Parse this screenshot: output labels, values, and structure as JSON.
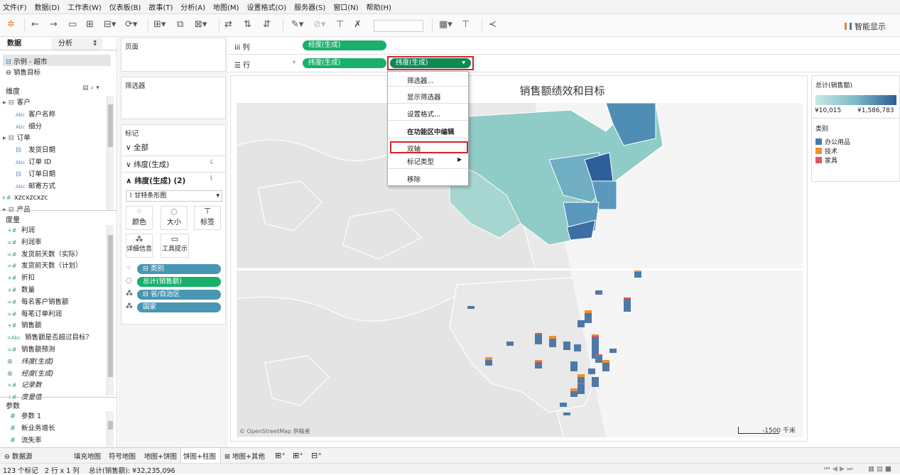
{
  "menu": [
    "文件(F)",
    "数据(D)",
    "工作表(W)",
    "仪表板(B)",
    "故事(T)",
    "分析(A)",
    "地图(M)",
    "设置格式(O)",
    "服务器(S)",
    "窗口(N)",
    "帮助(H)"
  ],
  "toolbar": {
    "smart_show": "智能显示"
  },
  "left": {
    "tab_data": "数据",
    "tab_analysis": "分析",
    "datasources": [
      "示例 - 超市",
      "销售目标"
    ],
    "dimensions_title": "维度",
    "dimensions": [
      {
        "label": "客户",
        "kind": "folder"
      },
      {
        "label": "客户名称",
        "kind": "abc"
      },
      {
        "label": "细分",
        "kind": "abc"
      },
      {
        "label": "订单",
        "kind": "folder"
      },
      {
        "label": "发货日期",
        "kind": "date"
      },
      {
        "label": "订单 ID",
        "kind": "abc"
      },
      {
        "label": "订单日期",
        "kind": "date"
      },
      {
        "label": "邮寄方式",
        "kind": "abc"
      },
      {
        "label": "xzcxzcxzc",
        "kind": "num"
      },
      {
        "label": "产品",
        "kind": "folder"
      }
    ],
    "measures_title": "度量",
    "measures": [
      {
        "label": "利润",
        "kind": "num"
      },
      {
        "label": "利润率",
        "kind": "numc"
      },
      {
        "label": "发货前天数（实际）",
        "kind": "numc"
      },
      {
        "label": "发货前天数（计划）",
        "kind": "numc"
      },
      {
        "label": "折扣",
        "kind": "num"
      },
      {
        "label": "数量",
        "kind": "num"
      },
      {
        "label": "每名客户销售额",
        "kind": "numc"
      },
      {
        "label": "每笔订单利润",
        "kind": "numc"
      },
      {
        "label": "销售额",
        "kind": "num"
      },
      {
        "label": "销售额是否超过目标？",
        "kind": "abcc"
      },
      {
        "label": "销售额预测",
        "kind": "numc"
      },
      {
        "label": "纬度(生成)",
        "kind": "geo"
      },
      {
        "label": "经度(生成)",
        "kind": "geo"
      },
      {
        "label": "记录数",
        "kind": "num"
      },
      {
        "label": "度量值",
        "kind": "num"
      }
    ],
    "params_title": "参数",
    "params": [
      "参数 1",
      "新业务增长",
      "流失率"
    ]
  },
  "middle": {
    "pages_title": "页面",
    "filters_title": "筛选器",
    "marks_title": "标记",
    "marks_all": "全部",
    "marks_lon": "纬度(生成)",
    "marks_lat": "纬度(生成) (2)",
    "mark_type": "甘特条形图",
    "btn_color": "颜色",
    "btn_size": "大小",
    "btn_label": "标签",
    "btn_detail": "详细信息",
    "btn_tooltip": "工具提示",
    "pills": [
      "类别",
      "总计(销售额)",
      "省/自治区",
      "国家"
    ]
  },
  "shelves": {
    "columns_label": "列",
    "rows_label": "行",
    "col_pill": "经度(生成)",
    "row_pill1": "纬度(生成)",
    "row_pill2": "纬度(生成)"
  },
  "view": {
    "title": "销售额绩效和目标",
    "attribution": "© OpenStreetMap 供稿者",
    "scale": "1500 千米"
  },
  "dropdown": {
    "items": [
      "筛选器...",
      "显示筛选器",
      "设置格式...",
      "在功能区中编辑",
      "双轴",
      "标记类型",
      "移除"
    ]
  },
  "legend": {
    "title": "总计(销售额)",
    "min": "¥10,015",
    "max": "¥1,586,783",
    "cat_title": "类别",
    "categories": [
      {
        "name": "办公用品",
        "color": "#4e79a7"
      },
      {
        "name": "技术",
        "color": "#f28e2b"
      },
      {
        "name": "家具",
        "color": "#e15759"
      }
    ]
  },
  "colors": {
    "green_pill": "#18b06b",
    "blue_pill": "#4996b2",
    "highlight": "#d4232b"
  },
  "tabs": {
    "datasource": "数据源",
    "sheets": [
      "填充地图",
      "符号地图",
      "地图+饼图",
      "饼图+柱图",
      "地图+其他"
    ]
  },
  "status": {
    "marks": "123 个标记",
    "rowscols": "2 行 x 1 列",
    "total": "总计(销售额): ¥32,235,096"
  }
}
